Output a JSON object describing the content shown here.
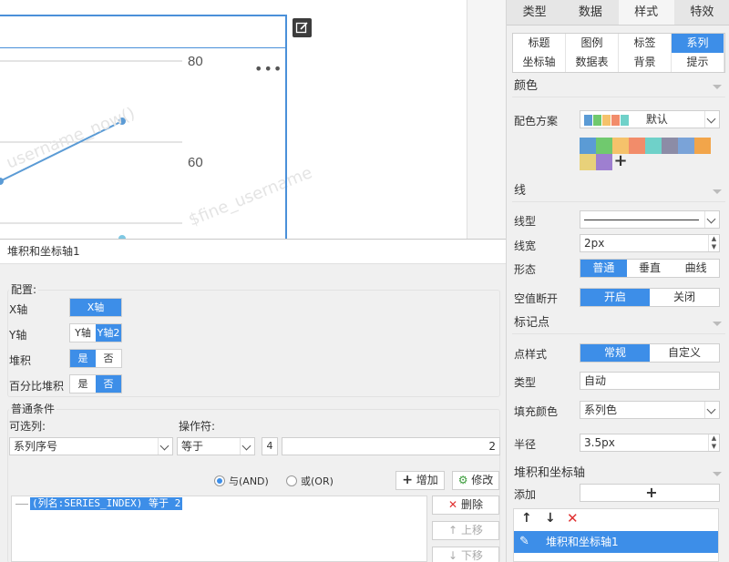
{
  "chart": {
    "yticks": [
      "80",
      "60"
    ],
    "watermark1": "username_now()",
    "watermark2": "$fine_username",
    "colors": {
      "line": "#5b9bd5",
      "frame": "#4a90d9"
    }
  },
  "panel": {
    "tabs": [
      "类型",
      "数据",
      "样式",
      "特效"
    ],
    "active_tab": "样式",
    "subtabs": [
      "标题",
      "图例",
      "标签",
      "系列",
      "坐标轴",
      "数据表",
      "背景",
      "提示"
    ],
    "active_subtab": "系列",
    "color_section": {
      "title": "颜色",
      "scheme_label": "配色方案",
      "scheme_value": "默认",
      "palette": [
        "#5b9bd5",
        "#70c96e",
        "#f5c26b",
        "#f28c6a",
        "#6fd1c9",
        "#8c8ca6",
        "#7aa3d8",
        "#f2a54a",
        "#e8d17a",
        "#9e7fd0"
      ]
    },
    "line_section": {
      "title": "线",
      "type_label": "线型",
      "width_label": "线宽",
      "width_value": "2px",
      "shape_label": "形态",
      "shape_options": [
        "普通",
        "垂直",
        "曲线"
      ],
      "null_label": "空值断开",
      "null_options": [
        "开启",
        "关闭"
      ]
    },
    "marker_section": {
      "title": "标记点",
      "style_label": "点样式",
      "style_options": [
        "常规",
        "自定义"
      ],
      "type_label": "类型",
      "type_value": "自动",
      "fill_label": "填充颜色",
      "fill_value": "系列色",
      "radius_label": "半径",
      "radius_value": "3.5px"
    },
    "stack_section": {
      "title": "堆积和坐标轴",
      "add_label": "添加",
      "item_label": "堆积和坐标轴1"
    }
  },
  "dialog": {
    "title": "堆积和坐标轴1",
    "config_label": "配置:",
    "x_axis_label": "X轴",
    "x_axis_value": "X轴",
    "y_axis_label": "Y轴",
    "y_axis_options": [
      "Y轴",
      "Y轴2"
    ],
    "stack_label": "堆积",
    "stack_options": [
      "是",
      "否"
    ],
    "percent_label": "百分比堆积",
    "percent_options": [
      "是",
      "否"
    ],
    "condition_label": "普通条件",
    "column_label": "可选列:",
    "column_value": "系列序号",
    "operator_label": "操作符:",
    "operator_value": "等于",
    "value_type_icon": "4",
    "value": "2",
    "and_label": "与(AND)",
    "or_label": "或(OR)",
    "add_btn": "增加",
    "modify_btn": "修改",
    "delete_btn": "删除",
    "up_btn": "上移",
    "down_btn": "下移",
    "condition_item": "(列名:SERIES_INDEX) 等于 2"
  }
}
